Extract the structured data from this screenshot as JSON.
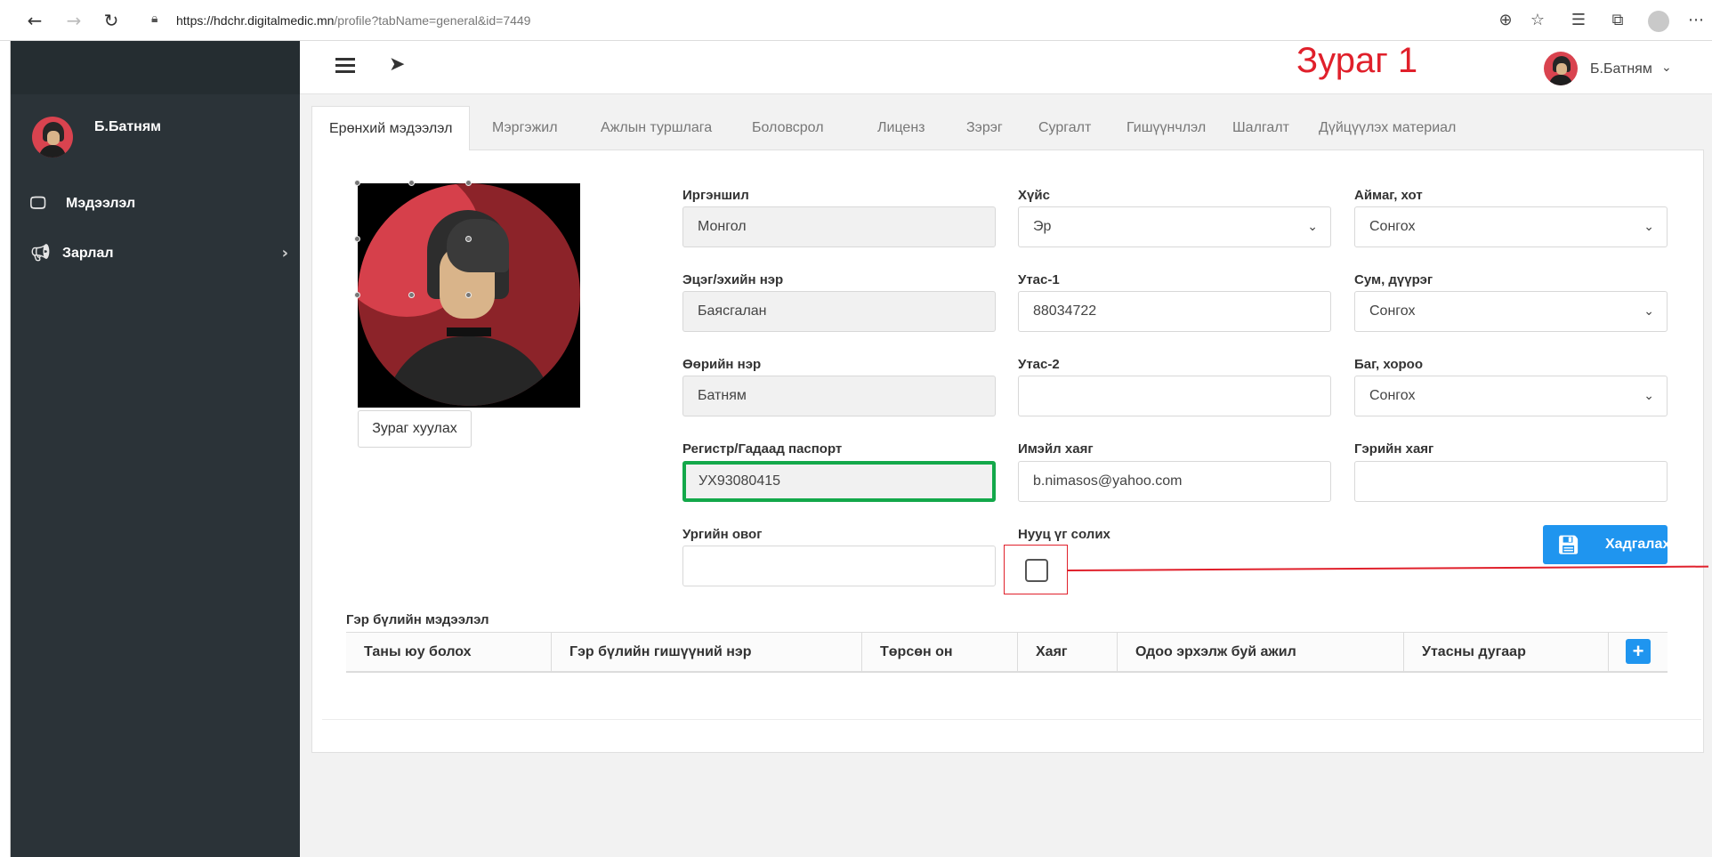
{
  "browser": {
    "url_host": "https://hdchr.digitalmedic.mn",
    "url_path": "/profile?tabName=general&id=7449"
  },
  "sidebar": {
    "user_name": "Б.Батням",
    "items": [
      {
        "label": "Мэдээлэл",
        "icon": "monitor-icon"
      },
      {
        "label": "Зарлал",
        "icon": "megaphone-icon"
      }
    ]
  },
  "header": {
    "caption": "Зураг 1",
    "user_name": "Б.Батням"
  },
  "tabs": [
    "Ерөнхий мэдээлэл",
    "Мэргэжил",
    "Ажлын туршлага",
    "Боловсрол",
    "Лиценз",
    "Зэрэг",
    "Сургалт",
    "Гишүүнчлэл",
    "Шалгалт",
    "Дүйцүүлэх материал"
  ],
  "photo": {
    "button_label": "Зураг хуулах"
  },
  "form": {
    "citizenship": {
      "label": "Иргэншил",
      "value": "Монгол"
    },
    "gender": {
      "label": "Хүйс",
      "value": "Эр"
    },
    "province": {
      "label": "Аймаг, хот",
      "value": "Сонгох"
    },
    "parent_name": {
      "label": "Эцэг/эхийн нэр",
      "value": "Баясгалан"
    },
    "phone1": {
      "label": "Утас-1",
      "value": "88034722"
    },
    "district": {
      "label": "Сум, дүүрэг",
      "value": "Сонгох"
    },
    "own_name": {
      "label": "Өөрийн нэр",
      "value": "Батням"
    },
    "phone2": {
      "label": "Утас-2",
      "value": ""
    },
    "khoroo": {
      "label": "Баг, хороо",
      "value": "Сонгох"
    },
    "register": {
      "label": "Регистр/Гадаад паспорт",
      "value": "УХ93080415"
    },
    "email": {
      "label": "Имэйл хаяг",
      "value": "b.nimasos@yahoo.com"
    },
    "home_address": {
      "label": "Гэрийн хаяг",
      "value": ""
    },
    "clan_name": {
      "label": "Ургийн овог",
      "value": ""
    },
    "change_password": {
      "label": "Нууц үг солих",
      "checked": false
    },
    "save_label": "Хадгалах"
  },
  "family": {
    "title": "Гэр бүлийн мэдээлэл",
    "columns": [
      "Таны юу болох",
      "Гэр бүлийн гишүүний нэр",
      "Төрсөн он",
      "Хаяг",
      "Одоо эрхэлж буй ажил",
      "Утасны дугаар"
    ],
    "add_label": "+"
  },
  "colors": {
    "sidebar_bg": "#2b3338",
    "primary": "#1f95ef",
    "highlight_green": "#13a84a",
    "annotation_red": "#e0202b"
  }
}
